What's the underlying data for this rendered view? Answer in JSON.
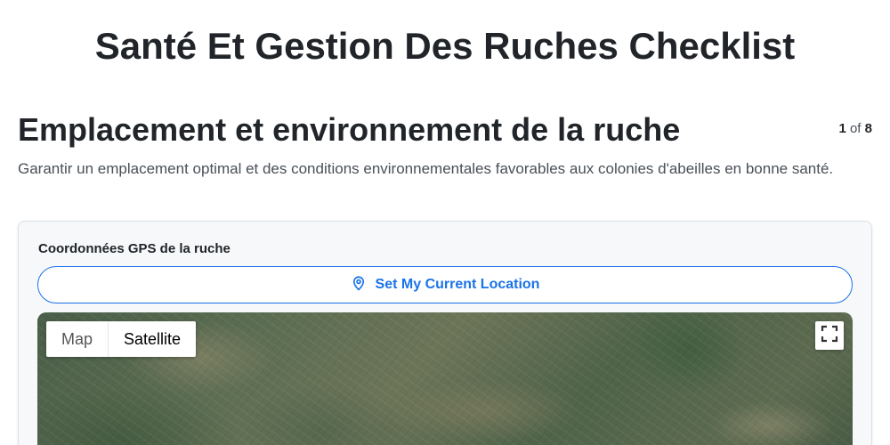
{
  "page": {
    "title": "Santé Et Gestion Des Ruches Checklist"
  },
  "section": {
    "title": "Emplacement et environnement de la ruche",
    "current": "1",
    "of": "of",
    "total": "8",
    "description": "Garantir un emplacement optimal et des conditions environnementales favorables aux colonies d'abeilles en bonne santé."
  },
  "gps_field": {
    "label": "Coordonnées GPS de la ruche",
    "location_button": "Set My Current Location",
    "location_icon": "map-pin-icon"
  },
  "map": {
    "type_options": [
      "Map",
      "Satellite"
    ],
    "selected_type": "Satellite",
    "fullscreen_icon": "fullscreen-icon"
  },
  "colors": {
    "accent": "#1a73e8",
    "text": "#212529",
    "muted": "#495057",
    "card_bg": "#f6f8fa"
  }
}
